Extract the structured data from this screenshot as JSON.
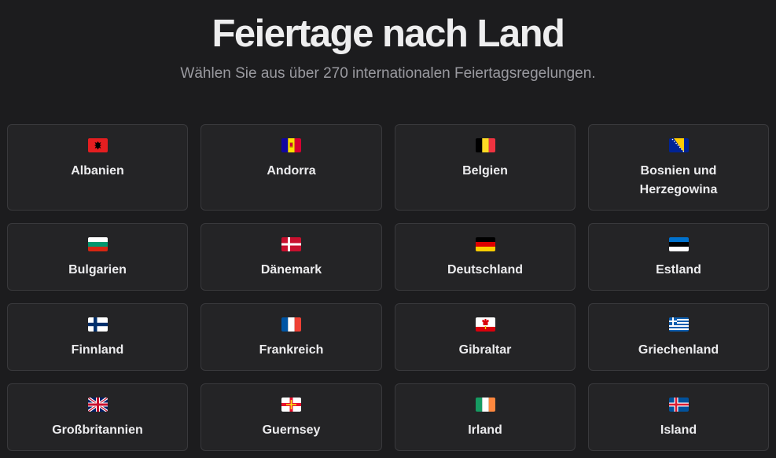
{
  "header": {
    "title": "Feiertage nach Land",
    "subtitle": "Wählen Sie aus über 270 internationalen Feiertagsregelungen."
  },
  "countries": [
    {
      "name": "Albanien",
      "icon": "albania-flag-icon"
    },
    {
      "name": "Andorra",
      "icon": "andorra-flag-icon"
    },
    {
      "name": "Belgien",
      "icon": "belgium-flag-icon"
    },
    {
      "name": "Bosnien und Herzegowina",
      "icon": "bosnia-flag-icon"
    },
    {
      "name": "Bulgarien",
      "icon": "bulgaria-flag-icon"
    },
    {
      "name": "Dänemark",
      "icon": "denmark-flag-icon"
    },
    {
      "name": "Deutschland",
      "icon": "germany-flag-icon"
    },
    {
      "name": "Estland",
      "icon": "estonia-flag-icon"
    },
    {
      "name": "Finnland",
      "icon": "finland-flag-icon"
    },
    {
      "name": "Frankreich",
      "icon": "france-flag-icon"
    },
    {
      "name": "Gibraltar",
      "icon": "gibraltar-flag-icon"
    },
    {
      "name": "Griechenland",
      "icon": "greece-flag-icon"
    },
    {
      "name": "Großbritannien",
      "icon": "uk-flag-icon"
    },
    {
      "name": "Guernsey",
      "icon": "guernsey-flag-icon"
    },
    {
      "name": "Irland",
      "icon": "ireland-flag-icon"
    },
    {
      "name": "Island",
      "icon": "iceland-flag-icon"
    }
  ]
}
